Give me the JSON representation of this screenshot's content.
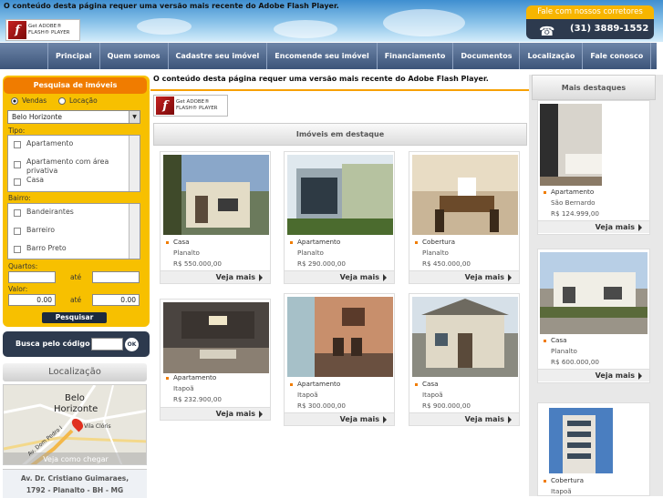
{
  "header": {
    "flash_message": "O conteúdo desta página requer uma versão mais recente do Adobe Flash Player.",
    "flash_button": {
      "line1": "Get ADOBE®",
      "line2": "FLASH® PLAYER"
    },
    "phone_label": "Fale com nossos corretores",
    "phone_number": "(31) 3889-1552"
  },
  "nav": {
    "items": [
      "Principal",
      "Quem somos",
      "Cadastre seu imóvel",
      "Encomende seu imóvel",
      "Financiamento",
      "Documentos",
      "Localização",
      "Fale conosco"
    ]
  },
  "search": {
    "title": "Pesquisa de imóveis",
    "mode_sale": "Vendas",
    "mode_rent": "Locação",
    "city": "Belo Horizonte",
    "tipo_label": "Tipo:",
    "tipos": [
      "Apartamento",
      "Apartamento com área privativa",
      "Casa"
    ],
    "bairro_label": "Bairro:",
    "bairros": [
      "Bandeirantes",
      "Barreiro",
      "Barro Preto"
    ],
    "quartos_label": "Quartos:",
    "ate": "até",
    "valor_label": "Valor:",
    "valor_min": "0.00",
    "valor_max": "0.00",
    "search_button": "Pesquisar"
  },
  "code_search": {
    "label": "Busca pelo código",
    "ok": "OK"
  },
  "location": {
    "title": "Localização",
    "map_city_1": "Belo",
    "map_city_2": "Horizonte",
    "map_area": "Vila Clóris",
    "map_road": "Av. Dom Pedro I",
    "map_link": "Veja como chegar",
    "address_line1": "Av. Dr. Cristiano Guimaraes,",
    "address_line2": "1792 - Planalto - BH - MG"
  },
  "main": {
    "flash_message": "O conteúdo desta página requer uma versão mais recente do Adobe Flash Player.",
    "section_title": "Imóveis em destaque",
    "cards": [
      {
        "type": "Casa",
        "area": "Planalto",
        "price": "R$ 550.000,00",
        "link": "Veja mais"
      },
      {
        "type": "Apartamento",
        "area": "Planalto",
        "price": "R$ 290.000,00",
        "link": "Veja mais"
      },
      {
        "type": "Cobertura",
        "area": "Planalto",
        "price": "R$ 450.000,00",
        "link": "Veja mais"
      },
      {
        "type": "Apartamento",
        "area": "Itapoã",
        "price": "R$ 232.900,00",
        "link": "Veja mais"
      },
      {
        "type": "Apartamento",
        "area": "Itapoã",
        "price": "R$ 300.000,00",
        "link": "Veja mais"
      },
      {
        "type": "Casa",
        "area": "Itapoã",
        "price": "R$ 900.000,00",
        "link": "Veja mais"
      }
    ]
  },
  "highlights": {
    "title": "Mais destaques",
    "cards": [
      {
        "type": "Apartamento",
        "area": "São Bernardo",
        "price": "R$ 124.999,00",
        "link": "Veja mais"
      },
      {
        "type": "Casa",
        "area": "Planalto",
        "price": "R$ 600.000,00",
        "link": "Veja mais"
      },
      {
        "type": "Cobertura",
        "area": "Itapoã"
      }
    ]
  },
  "colors": {
    "accent_orange": "#f07c00",
    "panel_yellow": "#f7c000",
    "nav_blue": "#3c5479",
    "dark_navy": "#2d3a4e"
  }
}
